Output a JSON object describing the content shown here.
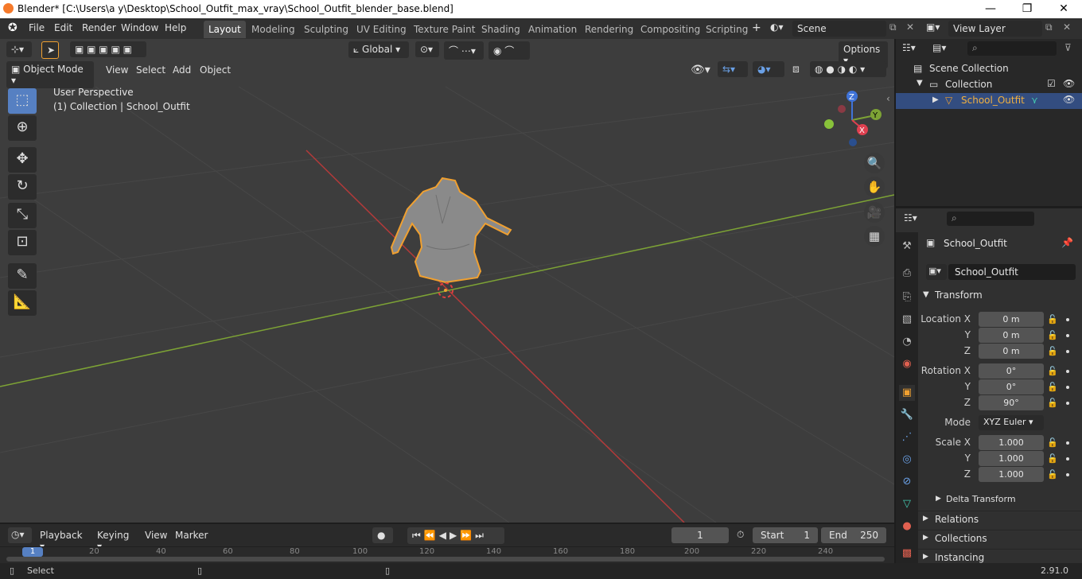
{
  "window": {
    "title": "Blender* [C:\\Users\\a y\\Desktop\\School_Outfit_max_vray\\School_Outfit_blender_base.blend]",
    "minimize": "—",
    "maximize": "❐",
    "close": "✕"
  },
  "menubar": {
    "items": [
      "File",
      "Edit",
      "Render",
      "Window",
      "Help"
    ]
  },
  "workspaces": [
    "Layout",
    "Modeling",
    "Sculpting",
    "UV Editing",
    "Texture Paint",
    "Shading",
    "Animation",
    "Rendering",
    "Compositing",
    "Scripting"
  ],
  "workspace_add": "+",
  "scene": {
    "name": "Scene",
    "view_layer": "View Layer"
  },
  "viewport": {
    "orientation": "Global",
    "options_label": "Options",
    "mode": "Object Mode",
    "menus": [
      "View",
      "Select",
      "Add",
      "Object"
    ],
    "overlay_title": "User Perspective",
    "overlay_sub": "(1) Collection | School_Outfit",
    "gizmo": {
      "x": "X",
      "y": "Y",
      "z": "Z"
    }
  },
  "outliner": {
    "rows": [
      {
        "label": "Scene Collection"
      },
      {
        "label": "Collection"
      },
      {
        "label": "School_Outfit"
      }
    ]
  },
  "properties": {
    "object_name": "School_Outfit",
    "data_name": "School_Outfit",
    "transform_header": "Transform",
    "location": {
      "label": "Location X",
      "x": "0 m",
      "y": "0 m",
      "z": "0 m"
    },
    "rotation": {
      "label": "Rotation X",
      "x": "0°",
      "y": "0°",
      "z": "90°"
    },
    "mode_label": "Mode",
    "mode_value": "XYZ Euler",
    "scale": {
      "label": "Scale X",
      "x": "1.000",
      "y": "1.000",
      "z": "1.000"
    },
    "axis_y": "Y",
    "axis_z": "Z",
    "delta": "Delta Transform",
    "relations": "Relations",
    "collections": "Collections",
    "instancing": "Instancing"
  },
  "timeline": {
    "menus": [
      "Playback",
      "Keying",
      "View",
      "Marker"
    ],
    "current_frame": "1",
    "start_label": "Start",
    "start_value": "1",
    "end_label": "End",
    "end_value": "250",
    "ruler": [
      "1",
      "20",
      "40",
      "60",
      "80",
      "100",
      "120",
      "140",
      "160",
      "180",
      "200",
      "220",
      "240"
    ]
  },
  "status": {
    "left": "Select",
    "version": "2.91.0"
  },
  "colors": {
    "accent_blue": "#5680c2",
    "selection_orange": "#f0a030",
    "axis_red": "#b33a3a",
    "axis_green": "#7da335"
  }
}
